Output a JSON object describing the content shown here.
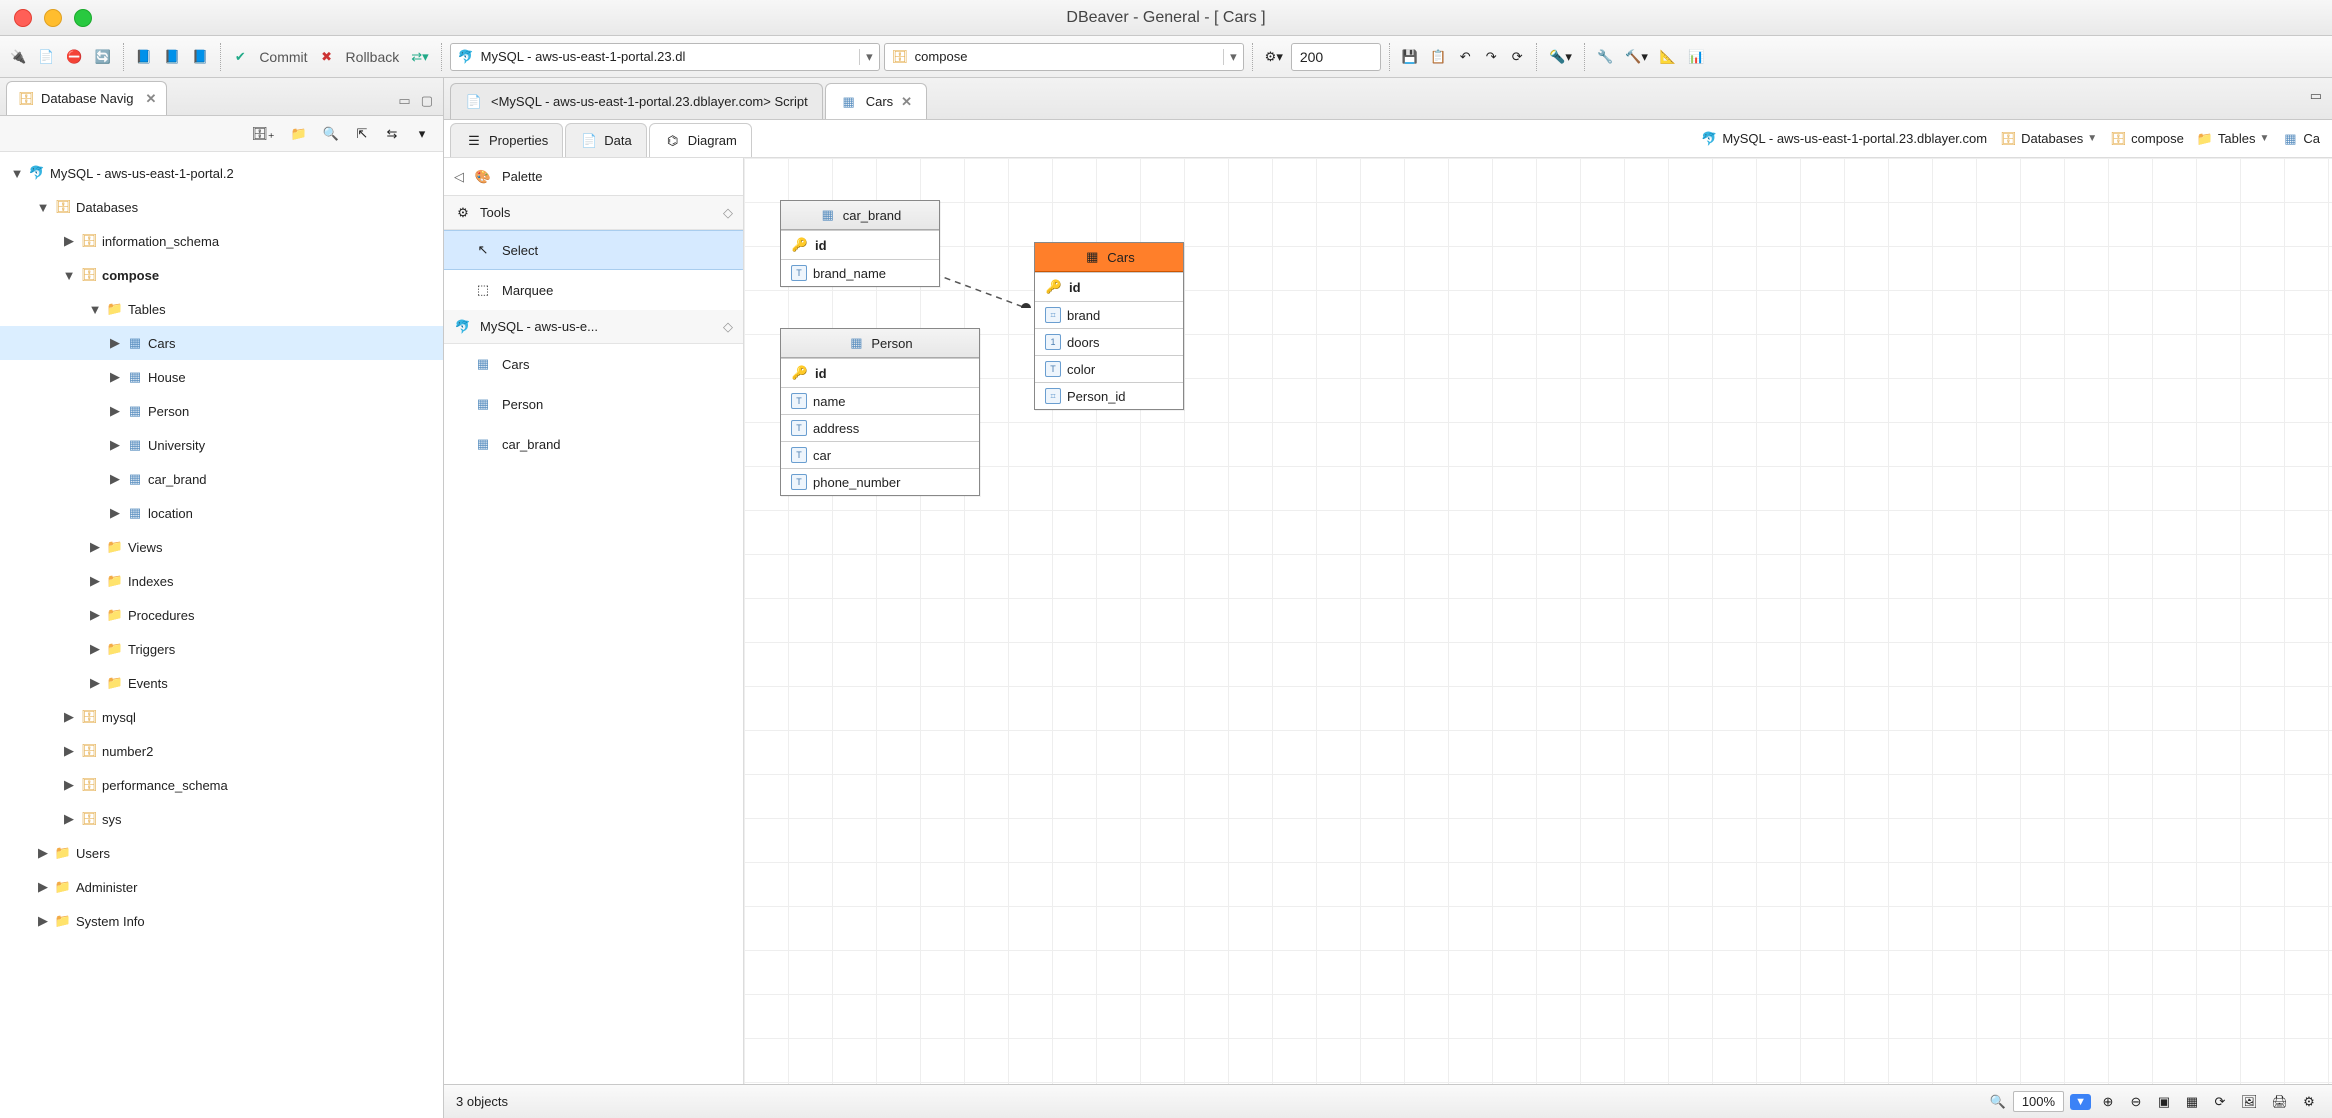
{
  "window": {
    "title": "DBeaver - General - [ Cars ]"
  },
  "toolbar": {
    "commit": "Commit",
    "rollback": "Rollback",
    "connection_combo": "MySQL - aws-us-east-1-portal.23.dl",
    "schema_combo": "compose",
    "limit_value": "200"
  },
  "sidebar": {
    "tab_title": "Database Navig",
    "tree": [
      {
        "level": 0,
        "expand": "open",
        "icon": "mysql",
        "label": "MySQL - aws-us-east-1-portal.2",
        "bold": false
      },
      {
        "level": 1,
        "expand": "open",
        "icon": "db",
        "label": "Databases",
        "bold": false
      },
      {
        "level": 2,
        "expand": "closed",
        "icon": "db",
        "label": "information_schema",
        "bold": false
      },
      {
        "level": 2,
        "expand": "open",
        "icon": "db",
        "label": "compose",
        "bold": true
      },
      {
        "level": 3,
        "expand": "open",
        "icon": "folder",
        "label": "Tables",
        "bold": false
      },
      {
        "level": 4,
        "expand": "closed",
        "icon": "table",
        "label": "Cars",
        "bold": false,
        "selected": true
      },
      {
        "level": 4,
        "expand": "closed",
        "icon": "table",
        "label": "House",
        "bold": false
      },
      {
        "level": 4,
        "expand": "closed",
        "icon": "table",
        "label": "Person",
        "bold": false
      },
      {
        "level": 4,
        "expand": "closed",
        "icon": "table",
        "label": "University",
        "bold": false
      },
      {
        "level": 4,
        "expand": "closed",
        "icon": "table",
        "label": "car_brand",
        "bold": false
      },
      {
        "level": 4,
        "expand": "closed",
        "icon": "table",
        "label": "location",
        "bold": false
      },
      {
        "level": 3,
        "expand": "closed",
        "icon": "folder",
        "label": "Views",
        "bold": false
      },
      {
        "level": 3,
        "expand": "closed",
        "icon": "folder",
        "label": "Indexes",
        "bold": false
      },
      {
        "level": 3,
        "expand": "closed",
        "icon": "folder",
        "label": "Procedures",
        "bold": false
      },
      {
        "level": 3,
        "expand": "closed",
        "icon": "folder",
        "label": "Triggers",
        "bold": false
      },
      {
        "level": 3,
        "expand": "closed",
        "icon": "folder",
        "label": "Events",
        "bold": false
      },
      {
        "level": 2,
        "expand": "closed",
        "icon": "db",
        "label": "mysql",
        "bold": false
      },
      {
        "level": 2,
        "expand": "closed",
        "icon": "db",
        "label": "number2",
        "bold": false
      },
      {
        "level": 2,
        "expand": "closed",
        "icon": "db",
        "label": "performance_schema",
        "bold": false
      },
      {
        "level": 2,
        "expand": "closed",
        "icon": "db",
        "label": "sys",
        "bold": false
      },
      {
        "level": 1,
        "expand": "closed",
        "icon": "folder",
        "label": "Users",
        "bold": false
      },
      {
        "level": 1,
        "expand": "closed",
        "icon": "folder",
        "label": "Administer",
        "bold": false
      },
      {
        "level": 1,
        "expand": "closed",
        "icon": "folder",
        "label": "System Info",
        "bold": false
      }
    ]
  },
  "editor_tabs": {
    "inactive": "<MySQL - aws-us-east-1-portal.23.dblayer.com> Script",
    "active": "Cars"
  },
  "sub_tabs": {
    "properties": "Properties",
    "data": "Data",
    "diagram": "Diagram"
  },
  "breadcrumb": {
    "conn": "MySQL - aws-us-east-1-portal.23.dblayer.com",
    "databases": "Databases",
    "db": "compose",
    "tables": "Tables",
    "tbl_partial": "Ca"
  },
  "palette": {
    "title": "Palette",
    "tools_header": "Tools",
    "select": "Select",
    "marquee": "Marquee",
    "conn_header": "MySQL - aws-us-e...",
    "items": [
      "Cars",
      "Person",
      "car_brand"
    ]
  },
  "diagram": {
    "car_brand": {
      "title": "car_brand",
      "cols": [
        {
          "n": "id",
          "t": "pk"
        },
        {
          "n": "brand_name",
          "t": "text"
        }
      ]
    },
    "cars": {
      "title": "Cars",
      "cols": [
        {
          "n": "id",
          "t": "pk"
        },
        {
          "n": "brand",
          "t": "fk"
        },
        {
          "n": "doors",
          "t": "num"
        },
        {
          "n": "color",
          "t": "text"
        },
        {
          "n": "Person_id",
          "t": "fk"
        }
      ]
    },
    "person": {
      "title": "Person",
      "cols": [
        {
          "n": "id",
          "t": "pk"
        },
        {
          "n": "name",
          "t": "text"
        },
        {
          "n": "address",
          "t": "text"
        },
        {
          "n": "car",
          "t": "text"
        },
        {
          "n": "phone_number",
          "t": "text"
        }
      ]
    }
  },
  "status": {
    "objects": "3 objects",
    "zoom": "100%"
  }
}
